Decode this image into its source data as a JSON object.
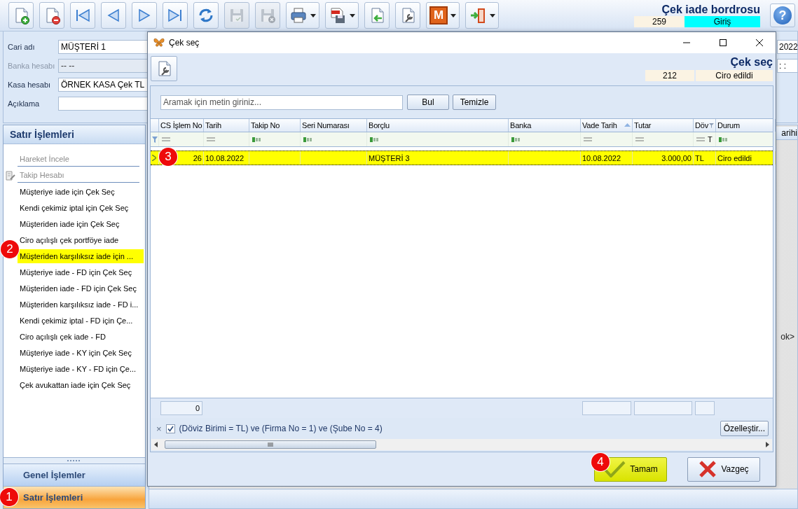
{
  "toolbar": {
    "buttons": [
      {
        "kind": "new",
        "disabled": false,
        "has_menu": false
      },
      {
        "kind": "delete",
        "disabled": false,
        "has_menu": false
      },
      {
        "kind": "first",
        "disabled": false,
        "has_menu": false
      },
      {
        "kind": "prev",
        "disabled": false,
        "has_menu": false
      },
      {
        "kind": "next",
        "disabled": false,
        "has_menu": false
      },
      {
        "kind": "last",
        "disabled": false,
        "has_menu": false
      },
      {
        "kind": "refresh",
        "disabled": false,
        "has_menu": false
      },
      {
        "kind": "save",
        "disabled": true,
        "has_menu": false
      },
      {
        "kind": "save_cancel",
        "disabled": true,
        "has_menu": false
      },
      {
        "kind": "print",
        "disabled": false,
        "has_menu": true
      },
      {
        "kind": "pdf",
        "disabled": false,
        "has_menu": true
      },
      {
        "kind": "import",
        "disabled": false,
        "has_menu": false
      },
      {
        "kind": "settings",
        "disabled": false,
        "has_menu": false
      },
      {
        "kind": "letter",
        "label": "M",
        "disabled": false,
        "has_menu": true
      },
      {
        "kind": "exit",
        "disabled": false,
        "has_menu": true
      }
    ],
    "title": "Çek iade bordrosu",
    "record_no": "259",
    "mode": "Giriş",
    "help": "?"
  },
  "form": {
    "fields": [
      {
        "label": "Cari adı",
        "value": "MÜŞTERİ 1",
        "disabled": false
      },
      {
        "label": "Banka hesabı",
        "value": "-- --",
        "disabled": true
      },
      {
        "label": "Kasa hesabı",
        "value": "ÖRNEK KASA Çek TL",
        "disabled": false
      },
      {
        "label": "Açıklama",
        "disabled": false
      }
    ],
    "right_fields": [
      "2022",
      ": :"
    ]
  },
  "sidebar": {
    "title": "Satır İşlemleri",
    "items": [
      {
        "label": "Hareket İncele",
        "disabled": true,
        "selected": false,
        "separator": true,
        "has_icon": false
      },
      {
        "label": "Takip Hesabı",
        "disabled": true,
        "selected": false,
        "separator": true,
        "has_icon": true
      },
      {
        "label": "Müşteriye iade için Çek Seç",
        "disabled": false,
        "selected": false,
        "separator": false,
        "has_icon": false
      },
      {
        "label": "Kendi çekimiz iptal için Çek Seç",
        "disabled": false,
        "selected": false,
        "separator": false,
        "has_icon": false
      },
      {
        "label": "Müşteriden iade için Çek Seç",
        "disabled": false,
        "selected": false,
        "separator": false,
        "has_icon": false
      },
      {
        "label": "Ciro açılışlı çek portföye iade",
        "disabled": false,
        "selected": false,
        "separator": false,
        "has_icon": false
      },
      {
        "label": "Müşteriden karşılıksız iade için ...",
        "disabled": false,
        "selected": true,
        "separator": false,
        "has_icon": false
      },
      {
        "label": "Müşteriye iade - FD için Çek Seç",
        "disabled": false,
        "selected": false,
        "separator": false,
        "has_icon": false
      },
      {
        "label": "Müşteriden iade - FD için Çek Seç",
        "disabled": false,
        "selected": false,
        "separator": false,
        "has_icon": false
      },
      {
        "label": "Müşteriden karşılıksız iade - FD i...",
        "disabled": false,
        "selected": false,
        "separator": false,
        "has_icon": false
      },
      {
        "label": "Kendi çekimiz iptal - FD için Çe...",
        "disabled": false,
        "selected": false,
        "separator": false,
        "has_icon": false
      },
      {
        "label": "Ciro açılışlı çek iade - FD",
        "disabled": false,
        "selected": false,
        "separator": false,
        "has_icon": false
      },
      {
        "label": "Müşteriye iade - KY için Çek Seç",
        "disabled": false,
        "selected": false,
        "separator": false,
        "has_icon": false
      },
      {
        "label": "Müşteriye iade - KY - FD için Çe...",
        "disabled": false,
        "selected": false,
        "separator": false,
        "has_icon": false
      },
      {
        "label": "Çek avukattan iade için Çek Seç",
        "disabled": false,
        "selected": false,
        "separator": false,
        "has_icon": false
      }
    ],
    "sections": [
      {
        "label": "Genel İşlemler",
        "selected": false
      },
      {
        "label": "Satır İşlemleri",
        "selected": true
      }
    ]
  },
  "background_grid": {
    "column_header": "arihi",
    "grid_text": "ok>"
  },
  "dialog": {
    "title": "Çek seç",
    "heading": "Çek seç",
    "record_no": "212",
    "status": "Ciro edildi",
    "search": {
      "placeholder": "Aramak için metin giriniz...",
      "buttons": [
        "Bul",
        "Temizle"
      ]
    },
    "columns": [
      {
        "label": "CS İşlem No",
        "kind": "number",
        "sorted_ascending": false,
        "filtered": false,
        "summary": true,
        "summary_value": "0"
      },
      {
        "label": "Tarih",
        "kind": "date",
        "sorted_ascending": false,
        "filtered": false,
        "summary": false
      },
      {
        "label": "Takip No",
        "kind": "text",
        "sorted_ascending": false,
        "filtered": false,
        "summary": false
      },
      {
        "label": "Seri Numarası",
        "kind": "text",
        "sorted_ascending": false,
        "filtered": false,
        "summary": false
      },
      {
        "label": "Borçlu",
        "kind": "text",
        "sorted_ascending": false,
        "filtered": false,
        "summary": false
      },
      {
        "label": "Banka",
        "kind": "text",
        "sorted_ascending": false,
        "filtered": false,
        "summary": false
      },
      {
        "label": "Vade Tarih",
        "kind": "date",
        "sorted_ascending": true,
        "filtered": false,
        "summary": true
      },
      {
        "label": "Tutar",
        "kind": "number",
        "sorted_ascending": false,
        "filtered": false,
        "summary": true
      },
      {
        "label": "Döv",
        "kind": "currency",
        "filter_value": "T",
        "sorted_ascending": false,
        "filtered": true,
        "summary": true
      },
      {
        "label": "Durum",
        "kind": "text",
        "sorted_ascending": false,
        "filtered": false,
        "summary": false
      }
    ],
    "rows": [
      {
        "selected": true,
        "cells": [
          "26",
          "10.08.2022",
          null,
          null,
          "MÜŞTERİ 3",
          null,
          "10.08.2022",
          "3.000,00",
          "TL",
          "Ciro edildi"
        ]
      }
    ],
    "filter_bar": {
      "clear": "×",
      "enabled": true,
      "text": "(Döviz Birimi = TL) ve (Firma No = 1) ve (Şube No = 4)",
      "button": "Özelleştir..."
    },
    "buttons": [
      {
        "kind": "ok",
        "label": "Tamam",
        "highlighted": true
      },
      {
        "kind": "cancel",
        "label": "Vazgeç",
        "highlighted": false
      }
    ]
  },
  "callouts": [
    "1",
    "2",
    "3",
    "4"
  ]
}
